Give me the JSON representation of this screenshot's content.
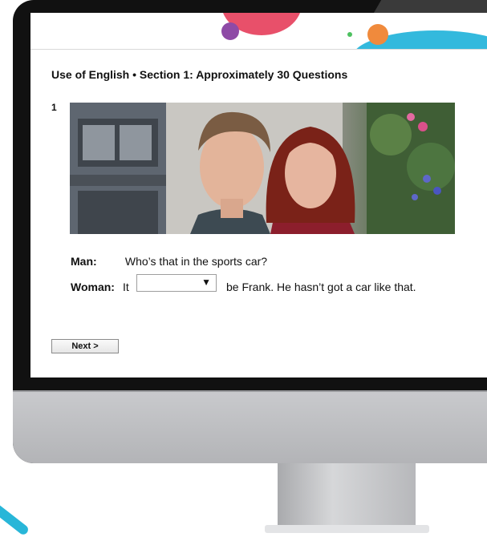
{
  "section_title": "Use of English • Section 1: Approximately 30 Questions",
  "question": {
    "number": "1",
    "photo_description_icon": "couple-photo",
    "lines": [
      {
        "speaker": "Man:",
        "text": "Who’s that in the sports car?"
      },
      {
        "speaker": "Woman:",
        "before": "It",
        "after": "be Frank. He hasn’t got a car like that."
      }
    ],
    "select": {
      "value": "",
      "arrow": "▼"
    }
  },
  "next_button": "Next >",
  "colors": {
    "blob_red": "#e8506a",
    "blob_purple": "#8e4aa6",
    "blob_cyan": "#33b9dd",
    "blob_orange": "#f08a3c",
    "blob_green": "#4dc160"
  }
}
